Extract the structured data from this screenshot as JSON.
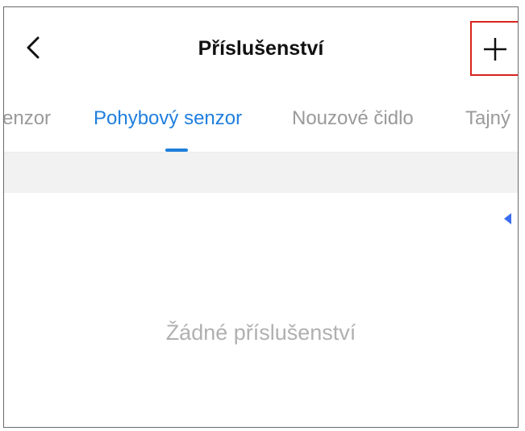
{
  "header": {
    "title": "Příslušenství",
    "back_icon": "chevron-left-icon",
    "add_icon": "plus-icon"
  },
  "tabs": [
    {
      "label": "enzor",
      "active": false
    },
    {
      "label": "Pohybový senzor",
      "active": true
    },
    {
      "label": "Nouzové čidlo",
      "active": false
    },
    {
      "label": "Tajný",
      "active": false
    }
  ],
  "empty_state": {
    "text": "Žádné příslušenství"
  },
  "colors": {
    "accent": "#1f7fde",
    "highlight_box": "#d9241c",
    "inactive_text": "#9a9a9a",
    "empty_text": "#b0b0b0"
  }
}
